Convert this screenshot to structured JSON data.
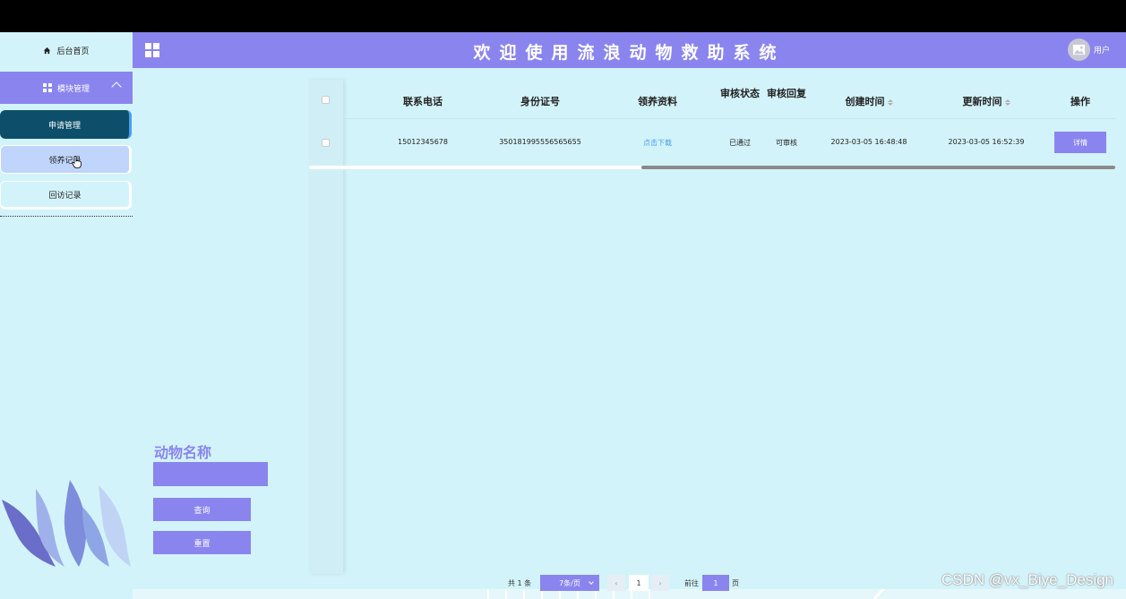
{
  "header": {
    "title": "欢迎使用流浪动物救助系统",
    "user_label": "用户"
  },
  "sidebar": {
    "home_label": "后台首页",
    "group_label": "模块管理",
    "items": [
      {
        "label": "申请管理",
        "state": "active"
      },
      {
        "label": "领养记录",
        "state": "hover"
      },
      {
        "label": "回访记录",
        "state": "normal"
      }
    ]
  },
  "search": {
    "field_label": "动物名称",
    "field_value": "",
    "query_label": "查询",
    "reset_label": "重置"
  },
  "table": {
    "columns": [
      "联系电话",
      "身份证号",
      "领养资料",
      "审核状态",
      "审核回复",
      "创建时间",
      "更新时间",
      "操作"
    ],
    "rows": [
      {
        "phone": "15012345678",
        "id_number": "350181995556565655",
        "material": "点击下载",
        "status": "已通过",
        "reply": "可审核",
        "created": "2023-03-05 16:48:48",
        "updated": "2023-03-05 16:52:39",
        "action": "详情"
      }
    ]
  },
  "pagination": {
    "total": "共 1 条",
    "page_size": "7条/页",
    "current_page": "1",
    "goto_label": "前往",
    "goto_value": "1",
    "page_suffix": "页"
  },
  "watermark": "CSDN @vx_Biye_Design",
  "colors": {
    "accent": "#8a85ee",
    "background": "#d3f3fa",
    "active_menu": "#0d4f6a",
    "link": "#4a9df0"
  }
}
